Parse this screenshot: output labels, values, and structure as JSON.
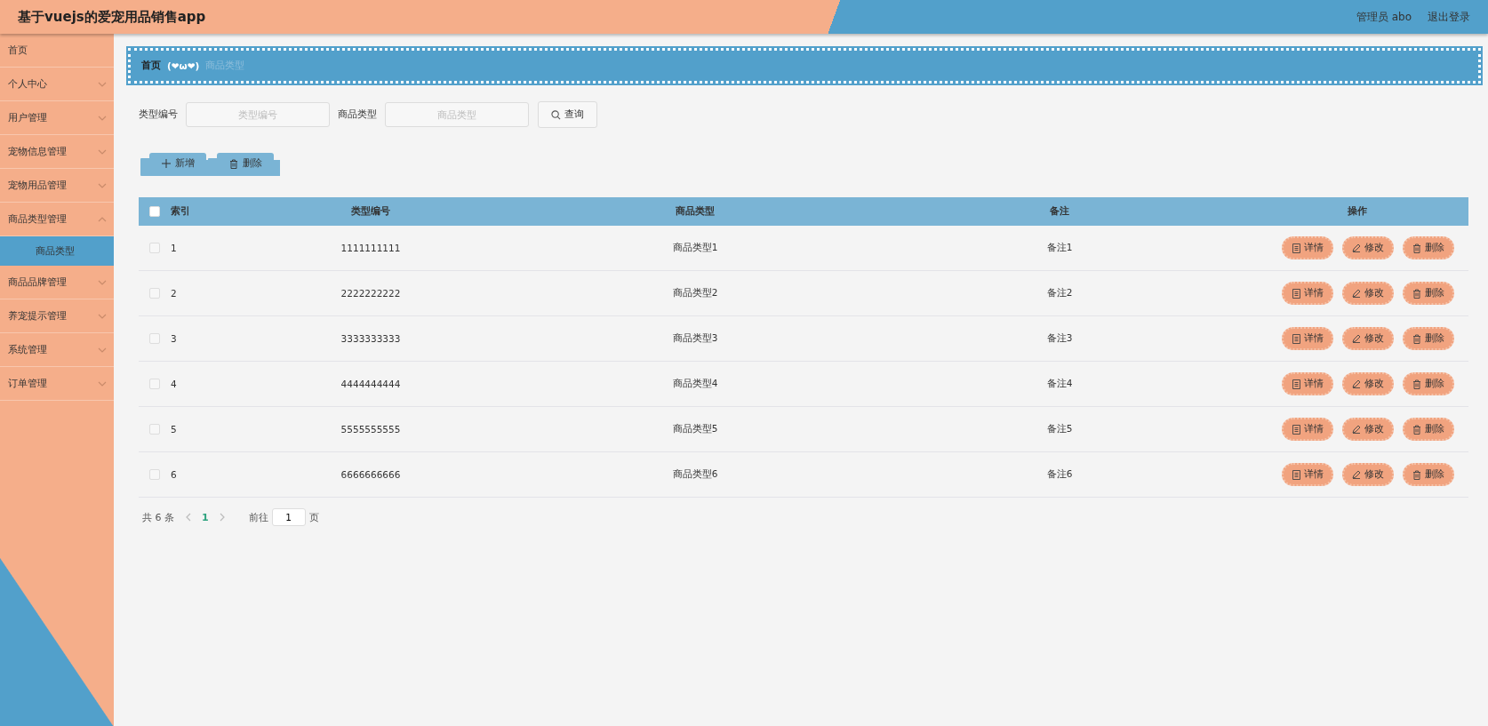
{
  "header": {
    "title": "基于vuejs的爱宠用品销售app",
    "user": "管理员 abo",
    "logout": "退出登录"
  },
  "sidebar": {
    "items": [
      {
        "label": "首页",
        "kind": "link"
      },
      {
        "label": "个人中心",
        "kind": "menu",
        "expanded": false
      },
      {
        "label": "用户管理",
        "kind": "menu",
        "expanded": false
      },
      {
        "label": "宠物信息管理",
        "kind": "menu",
        "expanded": false
      },
      {
        "label": "宠物用品管理",
        "kind": "menu",
        "expanded": false
      },
      {
        "label": "商品类型管理",
        "kind": "menu",
        "expanded": true,
        "children": [
          {
            "label": "商品类型",
            "selected": true
          }
        ]
      },
      {
        "label": "商品品牌管理",
        "kind": "menu",
        "expanded": false
      },
      {
        "label": "养宠提示管理",
        "kind": "menu",
        "expanded": false
      },
      {
        "label": "系统管理",
        "kind": "menu",
        "expanded": false
      },
      {
        "label": "订单管理",
        "kind": "menu",
        "expanded": false
      }
    ]
  },
  "breadcrumb": [
    {
      "label": "首页",
      "current": false
    },
    {
      "label": "(❤ω❤)",
      "kind": "separator",
      "current": false
    },
    {
      "label": "商品类型",
      "current": true
    }
  ],
  "search": {
    "fields": [
      {
        "label": "类型编号",
        "placeholder": "类型编号"
      },
      {
        "label": "商品类型",
        "placeholder": "商品类型"
      }
    ],
    "button": "查询"
  },
  "actions": [
    "新增",
    "删除"
  ],
  "table": {
    "select_all_checked": false,
    "columns": [
      "索引",
      "类型编号",
      "商品类型",
      "备注",
      "操作"
    ],
    "rows": [
      {
        "index": "1",
        "code": "1111111111",
        "type": "商品类型1",
        "note": "备注1",
        "checked": false,
        "actions": [
          "详情",
          "修改",
          "删除"
        ]
      },
      {
        "index": "2",
        "code": "2222222222",
        "type": "商品类型2",
        "note": "备注2",
        "checked": false,
        "actions": [
          "详情",
          "修改",
          "删除"
        ]
      },
      {
        "index": "3",
        "code": "3333333333",
        "type": "商品类型3",
        "note": "备注3",
        "checked": false,
        "actions": [
          "详情",
          "修改",
          "删除"
        ]
      },
      {
        "index": "4",
        "code": "4444444444",
        "type": "商品类型4",
        "note": "备注4",
        "checked": false,
        "actions": [
          "详情",
          "修改",
          "删除"
        ]
      },
      {
        "index": "5",
        "code": "5555555555",
        "type": "商品类型5",
        "note": "备注5",
        "checked": false,
        "actions": [
          "详情",
          "修改",
          "删除"
        ]
      },
      {
        "index": "6",
        "code": "6666666666",
        "type": "商品类型6",
        "note": "备注6",
        "checked": false,
        "actions": [
          "详情",
          "修改",
          "删除"
        ]
      }
    ]
  },
  "pagination": {
    "total": "共 6 条",
    "pages": [
      {
        "label": "1",
        "selected": true
      }
    ],
    "goto_label": "前往",
    "goto_value": "1",
    "page_unit": "页"
  }
}
